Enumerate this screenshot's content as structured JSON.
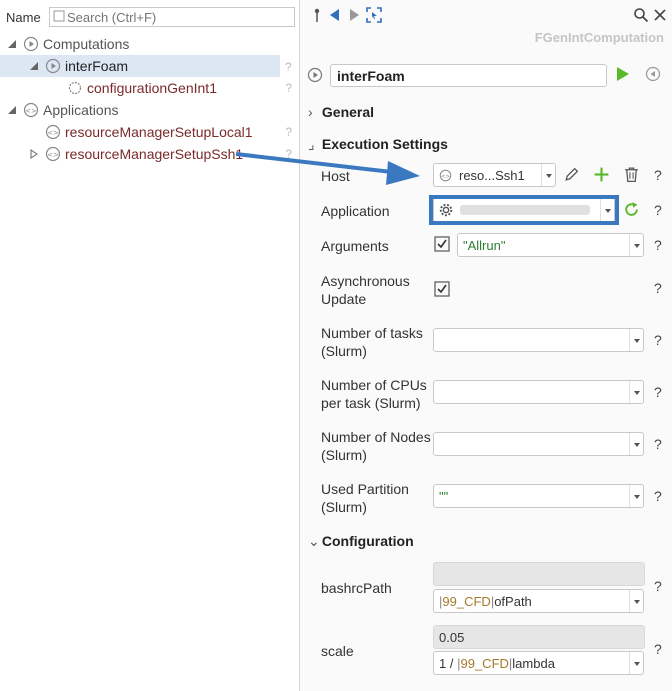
{
  "search": {
    "label": "Name",
    "placeholder": "Search (Ctrl+F)"
  },
  "tree": {
    "computations_label": "Computations",
    "interfoam_label": "interFoam",
    "config_label": "configurationGenInt1",
    "applications_label": "Applications",
    "local_label": "resourceManagerSetupLocal1",
    "ssh_label": "resourceManagerSetupSsh1",
    "help_mark": "?"
  },
  "panel": {
    "type_title": "FGenIntComputation",
    "name_value": "interFoam",
    "section_general": "General",
    "section_execution": "Execution Settings",
    "section_configuration": "Configuration",
    "help_mark": "?"
  },
  "fields": {
    "host_label": "Host",
    "host_value": "reso...Ssh1",
    "application_label": "Application",
    "arguments_label": "Arguments",
    "arguments_value": "\"Allrun\"",
    "async_label_1": "Asynchronous",
    "async_label_2": "Update",
    "tasks_label_1": "Number of tasks",
    "tasks_label_2": "(Slurm)",
    "cpus_label_1": "Number of CPUs",
    "cpus_label_2": "per task (Slurm)",
    "nodes_label_1": "Number of Nodes",
    "nodes_label_2": "(Slurm)",
    "partition_label_1": "Used Partition",
    "partition_label_2": "(Slurm)",
    "partition_value": "\"\"",
    "bashrc_label": "bashrcPath",
    "bashrc_prefix_pipe": "|",
    "bashrc_ref": "99_CFD",
    "bashrc_suffix": "ofPath",
    "scale_label": "scale",
    "scale_readonly": "0.05",
    "scale_prefix": "1 /",
    "scale_ref": "99_CFD",
    "scale_suffix": "lambda"
  },
  "colors": {
    "accent": "#3a78c0",
    "green": "#5cb82b",
    "string": "#2e7d32",
    "reference": "#a47a2a"
  }
}
